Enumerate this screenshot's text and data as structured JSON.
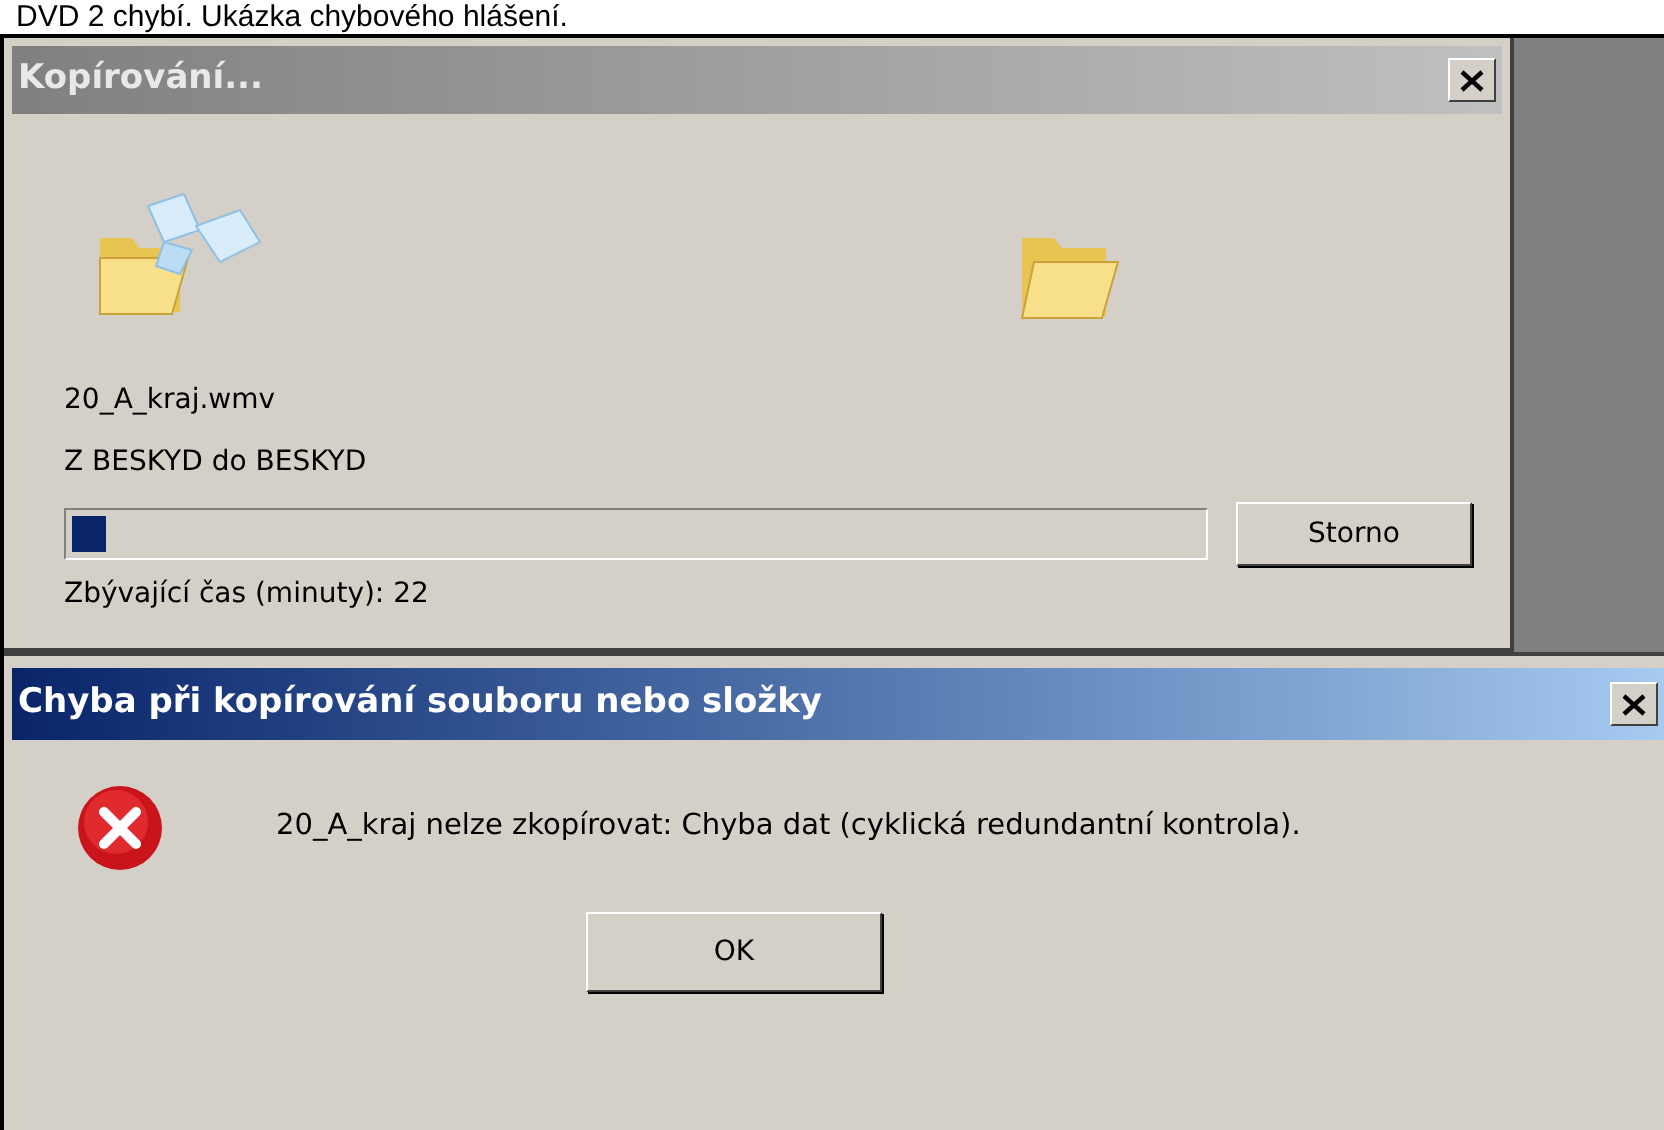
{
  "caption": "DVD 2 chybí. Ukázka chybového hlášení.",
  "copy_dialog": {
    "title": "Kopírování...",
    "active": false,
    "file_name": "20_A_kraj.wmv",
    "description": "Z BESKYD do BESKYD",
    "progress": {
      "level": 0.03
    },
    "cancel_button": "Storno",
    "remaining": "Zbývající čas (minuty): 22"
  },
  "error_dialog": {
    "title": "Chyba při kopírování souboru nebo složky",
    "active": true,
    "message": "20_A_kraj nelze zkopírovat: Chyba dat (cyklická redundantní kontrola).",
    "ok_button": "OK"
  }
}
